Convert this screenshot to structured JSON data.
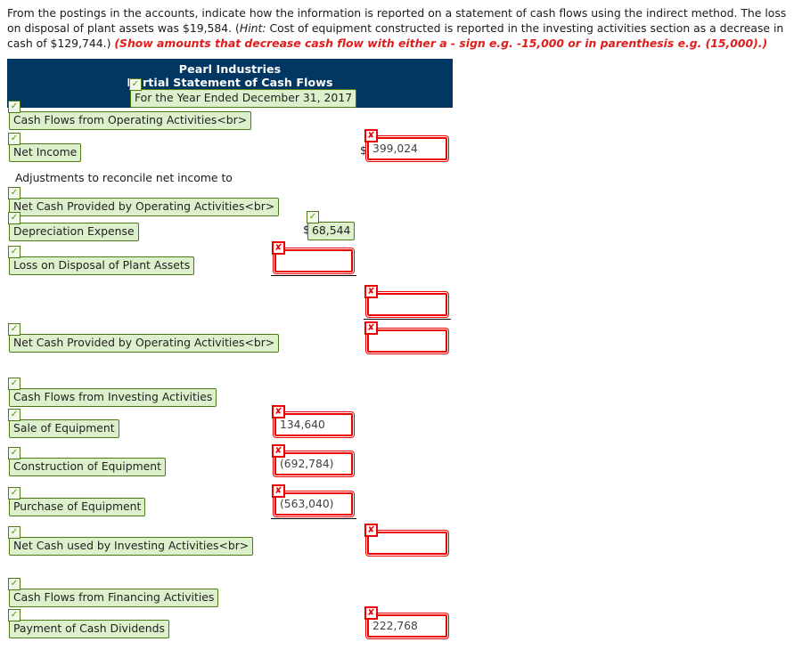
{
  "instructions": {
    "part1": "From the postings in the accounts, indicate how the information is reported on a statement of cash flows using the indirect method. The loss on disposal of plant assets was $19,584. (",
    "hint_word": "Hint:",
    "part2": " Cost of equipment constructed is reported in the investing activities section as a decrease in cash of $129,744.) ",
    "red_note": "(Show amounts that decrease cash flow with either a - sign e.g. -15,000 or in parenthesis e.g. (15,000).)"
  },
  "statement": {
    "company": "Pearl Industries",
    "title": "Partial Statement of Cash Flows",
    "period": "For the Year Ended December 31, 2017"
  },
  "rows": {
    "operating_header": "Cash Flows from Operating Activities<br>",
    "net_income": "Net Income",
    "net_income_value": "399,024",
    "adjust_text": "Adjustments to reconcile net income to",
    "net_cash_op_sub": "Net Cash Provided by Operating Activities<br>",
    "depreciation": "Depreciation Expense",
    "depreciation_value": "68,544",
    "loss_disposal": "Loss on Disposal of Plant Assets",
    "loss_disposal_value": "",
    "blank_adj_value": "",
    "net_cash_op_total": "Net Cash Provided by Operating Activities<br>",
    "net_cash_op_total_value": "",
    "investing_header": "Cash Flows from Investing Activities",
    "sale_equipment": "Sale of Equipment",
    "sale_equipment_value": "134,640",
    "construction_equipment": "Construction of Equipment",
    "construction_equipment_value": "(692,784)",
    "purchase_equipment": "Purchase of Equipment",
    "purchase_equipment_value": "(563,040)",
    "net_cash_investing": "Net Cash used by Investing Activities<br>",
    "net_cash_investing_value": "",
    "financing_header": "Cash Flows from Financing Activities",
    "dividends": "Payment of Cash Dividends",
    "dividends_value": "222,768"
  },
  "symbols": {
    "currency": "$",
    "check": "✓",
    "cross": "✘"
  },
  "colors": {
    "band_navy": "#023763",
    "correct_green_border": "#4e7a16",
    "correct_green_fill": "#ddf0cc",
    "incorrect_red": "#ee0000",
    "note_red": "#e01b1b"
  }
}
